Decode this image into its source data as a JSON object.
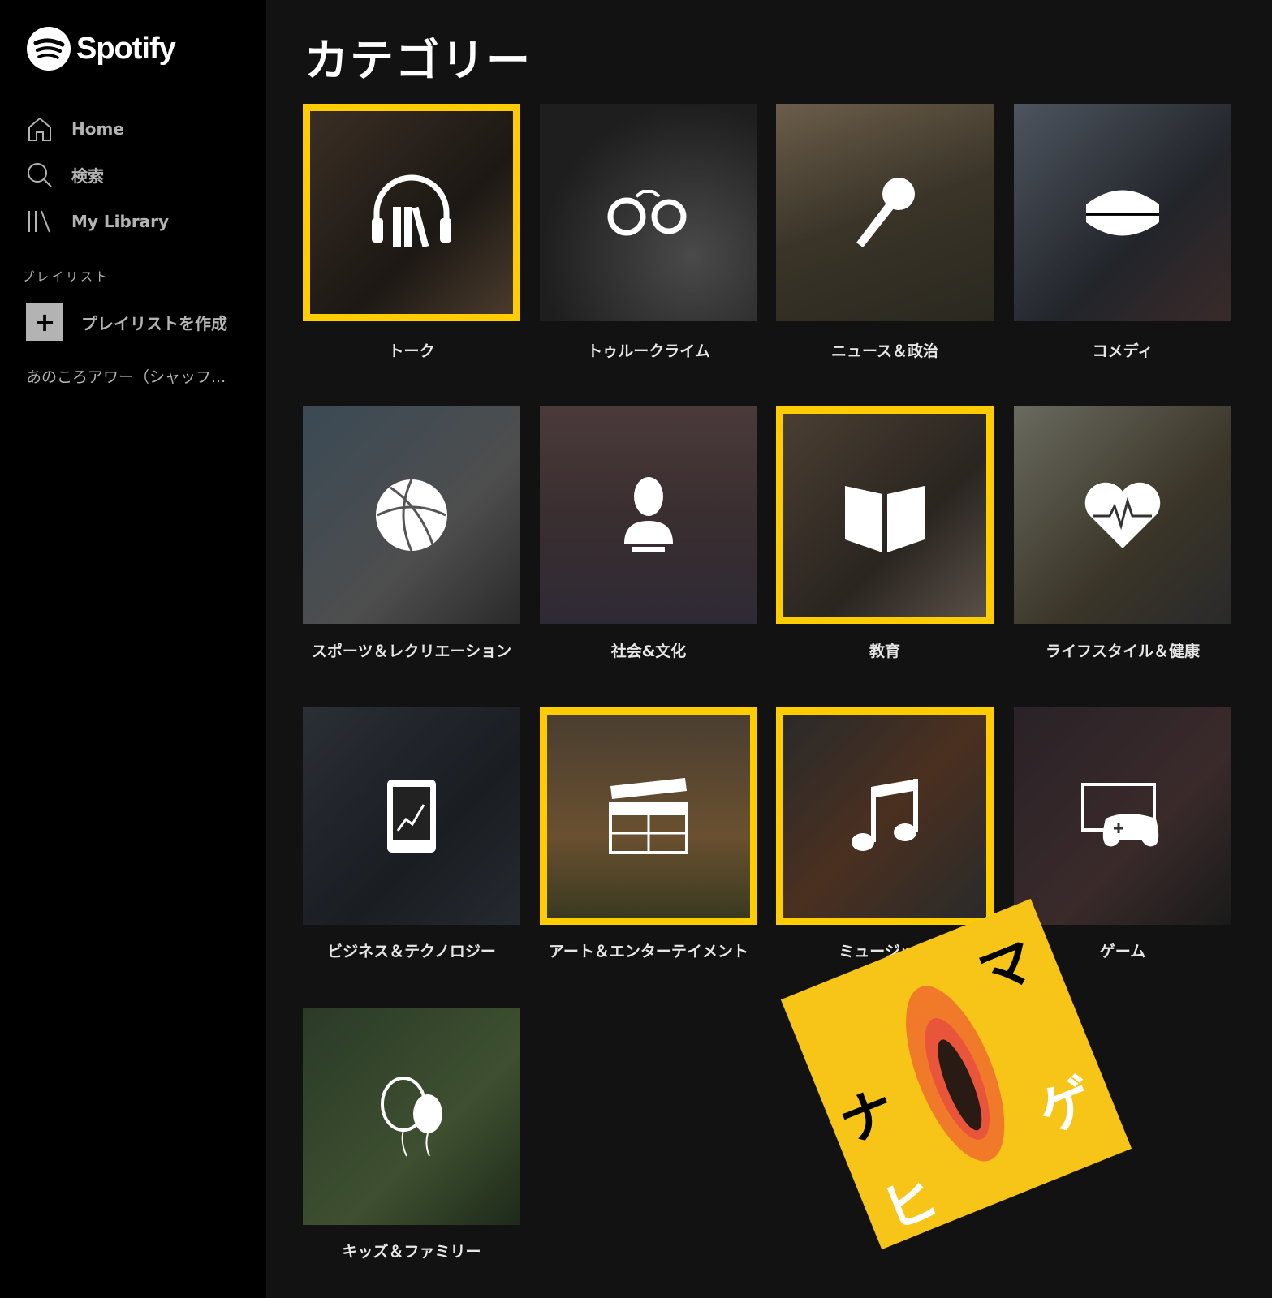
{
  "sidebar": {
    "brand": "Spotify",
    "nav": [
      {
        "label": "Home",
        "icon": "home-icon"
      },
      {
        "label": "検索",
        "icon": "search-icon"
      },
      {
        "label": "My Library",
        "icon": "library-icon"
      }
    ],
    "section_label": "プレイリスト",
    "create_label": "プレイリストを作成",
    "playlist_name": "あのころアワー（シャッフ..."
  },
  "main": {
    "title": "カテゴリー",
    "categories": [
      {
        "label": "トーク",
        "icon": "headphones-books-icon",
        "highlighted": true
      },
      {
        "label": "トゥルークライム",
        "icon": "handcuffs-icon",
        "highlighted": false
      },
      {
        "label": "ニュース＆政治",
        "icon": "microphone-icon",
        "highlighted": false
      },
      {
        "label": "コメディ",
        "icon": "chattering-teeth-icon",
        "highlighted": false
      },
      {
        "label": "スポーツ＆レクリエーション",
        "icon": "basketball-icon",
        "highlighted": false
      },
      {
        "label": "社会&文化",
        "icon": "bust-icon",
        "highlighted": false
      },
      {
        "label": "教育",
        "icon": "open-book-icon",
        "highlighted": true
      },
      {
        "label": "ライフスタイル＆健康",
        "icon": "heartbeat-icon",
        "highlighted": false
      },
      {
        "label": "ビジネス＆テクノロジー",
        "icon": "tablet-chart-icon",
        "highlighted": false
      },
      {
        "label": "アート＆エンターテイメント",
        "icon": "clapperboard-icon",
        "highlighted": true
      },
      {
        "label": "ミュージック",
        "icon": "music-note-icon",
        "highlighted": true
      },
      {
        "label": "ゲーム",
        "icon": "game-controller-icon",
        "highlighted": false
      },
      {
        "label": "キッズ＆ファミリー",
        "icon": "balloons-icon",
        "highlighted": false
      }
    ]
  },
  "podcast_art": {
    "chars": [
      "ナ",
      "マ",
      "ヒ",
      "ゲ"
    ]
  },
  "colors": {
    "highlight": "#ffcc00",
    "sidebar_bg": "#000000",
    "main_bg": "#121212",
    "podcast_bg": "#f7c418"
  }
}
